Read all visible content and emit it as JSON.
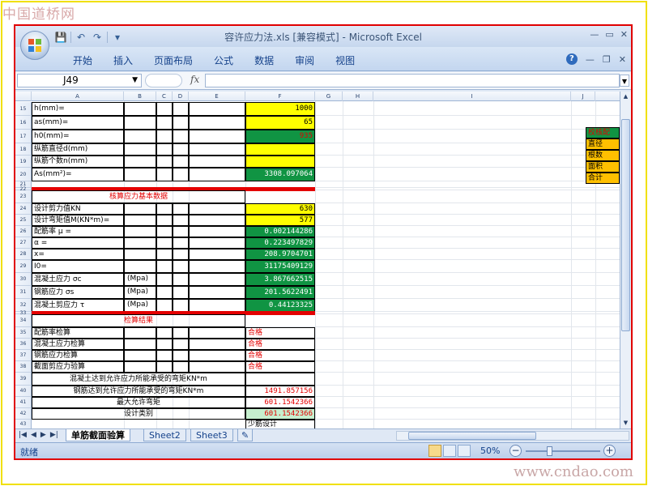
{
  "watermarks": {
    "top_left": "中国道桥网",
    "bottom_right": "www.cndao.com"
  },
  "window": {
    "title": "容许应力法.xls [兼容模式] - Microsoft Excel",
    "min": "—",
    "max": "▭",
    "close": "✕"
  },
  "qat": {
    "save": "💾",
    "undo": "↶",
    "redo": "↷",
    "customize": "▾"
  },
  "ribbon": {
    "tabs": [
      "开始",
      "插入",
      "页面布局",
      "公式",
      "数据",
      "审阅",
      "视图"
    ],
    "help": "?",
    "doc_min": "—",
    "doc_restore": "❐",
    "doc_close": "✕"
  },
  "formula_bar": {
    "name_box": "J49",
    "fx": "fx",
    "formula": ""
  },
  "columns": [
    "A",
    "B",
    "C",
    "D",
    "E",
    "F",
    "G",
    "H",
    "I",
    "J"
  ],
  "rows": [
    {
      "num": "15",
      "label": "h(mm)=",
      "value": "1000",
      "fill": "#ffff00",
      "color": "#000000"
    },
    {
      "num": "16",
      "label": "as(mm)=",
      "value": "65",
      "fill": "#ffff00",
      "color": "#000000"
    },
    {
      "num": "17",
      "label": "h0(mm)=",
      "value": "935",
      "fill": "#109443",
      "color": "#e30000"
    },
    {
      "num": "18",
      "label": "纵筋直径d(mm)",
      "value": "",
      "fill": "#ffff00",
      "color": "#000000"
    },
    {
      "num": "19",
      "label": "纵筋个数n(mm)",
      "value": "",
      "fill": "#ffff00",
      "color": "#000000"
    },
    {
      "num": "20",
      "label": "As(mm²)=",
      "value": "3308.097064",
      "fill": "#109443",
      "color": "#ffffff"
    },
    {
      "num": "21",
      "label": "",
      "value": "",
      "fill": "#ffffff",
      "color": "#000000"
    },
    {
      "num": "22",
      "label": "",
      "value": "",
      "fill": "#ffffff",
      "color": "#000000"
    },
    {
      "num": "23",
      "label": "",
      "value": "",
      "fill": "#ffffff",
      "color": "#000000"
    },
    {
      "num": "24",
      "label": "设计剪力值KN",
      "value": "630",
      "fill": "#ffff00",
      "color": "#000000"
    },
    {
      "num": "25",
      "label": "设计弯矩值M(KN*m)=",
      "value": "577",
      "fill": "#ffff00",
      "color": "#000000"
    },
    {
      "num": "26",
      "label": "配筋率 μ =",
      "value": "0.002144286",
      "fill": "#109443",
      "color": "#ffffff"
    },
    {
      "num": "27",
      "label": "α =",
      "value": "0.223497829",
      "fill": "#109443",
      "color": "#ffffff"
    },
    {
      "num": "28",
      "label": "x=",
      "value": "208.9704701",
      "fill": "#109443",
      "color": "#ffffff"
    },
    {
      "num": "29",
      "label": "I0=",
      "value": "31175409129",
      "fill": "#109443",
      "color": "#ffffff"
    },
    {
      "num": "30",
      "label": "混凝土应力 σc",
      "unit": "(Mpa)",
      "value": "3.867662515",
      "fill": "#109443",
      "color": "#ffffff"
    },
    {
      "num": "31",
      "label": "钢筋应力 σs",
      "unit": "(Mpa)",
      "value": "201.5622491",
      "fill": "#109443",
      "color": "#ffffff"
    },
    {
      "num": "32",
      "label": "混凝土剪应力 τ",
      "unit": "(Mpa)",
      "value": "0.44123325",
      "fill": "#109443",
      "color": "#ffffff"
    },
    {
      "num": "33",
      "label": "",
      "value": "",
      "fill": "#ffffff",
      "color": "#000000"
    },
    {
      "num": "34",
      "label": "",
      "value": "",
      "fill": "#ffffff",
      "color": "#000000"
    },
    {
      "num": "35",
      "label": "配筋率检算",
      "value": "合格",
      "fill": "#ffffff",
      "color": "#e30000",
      "align": "left"
    },
    {
      "num": "36",
      "label": "混凝土应力检算",
      "value": "合格",
      "fill": "#ffffff",
      "color": "#e30000",
      "align": "left"
    },
    {
      "num": "37",
      "label": "钢筋应力检算",
      "value": "合格",
      "fill": "#ffffff",
      "color": "#e30000",
      "align": "left"
    },
    {
      "num": "38",
      "label": "截面剪应力验算",
      "value": "合格",
      "fill": "#ffffff",
      "color": "#e30000",
      "align": "left"
    },
    {
      "num": "39",
      "label": "",
      "value": "",
      "fill": "#ffffff",
      "color": "#000000"
    },
    {
      "num": "40",
      "label": "",
      "value": "1491.857156",
      "fill": "#ffffff",
      "color": "#e30000"
    },
    {
      "num": "41",
      "label": "",
      "value": "601.1542366",
      "fill": "#ffffff",
      "color": "#e30000"
    },
    {
      "num": "42",
      "label": "",
      "value": "601.1542366",
      "fill": "#c6efce",
      "color": "#e30000"
    },
    {
      "num": "43",
      "label": "",
      "value": "少筋设计",
      "fill": "#ffffff",
      "color": "#000000",
      "align": "left"
    }
  ],
  "sections": {
    "check_basic": "核算应力基本数据",
    "check_result": "检算结果",
    "row40": "混凝土达到允许应力所能承受的弯矩KN*m",
    "row41": "钢筋达到允许应力所能承受的弯矩KN*m",
    "row42": "最大允许弯矩",
    "row43": "设计类别"
  },
  "side_panel": {
    "title": "校核配",
    "items": [
      "直径",
      "根数",
      "面积",
      "合计"
    ]
  },
  "sheet_tabs": [
    "单筋截面验算",
    "Sheet2",
    "Sheet3"
  ],
  "status": {
    "ready": "就绪",
    "zoom": "50%"
  },
  "colors": {
    "yellow": "#ffff00",
    "green": "#109443",
    "red": "#e30000",
    "orange": "#ffc000"
  }
}
